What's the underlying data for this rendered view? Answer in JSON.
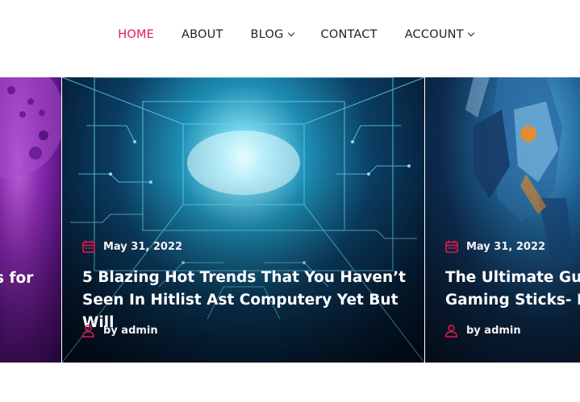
{
  "nav": {
    "items": [
      {
        "label": "HOME",
        "active": true,
        "dropdown": false
      },
      {
        "label": "ABOUT",
        "active": false,
        "dropdown": false
      },
      {
        "label": "BLOG",
        "active": false,
        "dropdown": true
      },
      {
        "label": "CONTACT",
        "active": false,
        "dropdown": false
      },
      {
        "label": "ACCOUNT",
        "active": false,
        "dropdown": true
      }
    ]
  },
  "colors": {
    "accent": "#e3184d",
    "nav_text": "#1f1f2e"
  },
  "slides": [
    {
      "title_visible": "s for"
    },
    {
      "date": "May 31, 2022",
      "title_line1": "5 Blazing Hot Trends That You Haven’t",
      "title_line2": "Seen In Hitlist Ast Computery Yet But Will",
      "author": "by admin",
      "icons": [
        "calendar-icon",
        "user-icon"
      ]
    },
    {
      "date": "May 31, 2022",
      "title_line1": "The Ultimate Guid",
      "title_line2": "Gaming Sticks- Re",
      "author": "by admin",
      "icons": [
        "calendar-icon",
        "user-icon"
      ]
    }
  ]
}
